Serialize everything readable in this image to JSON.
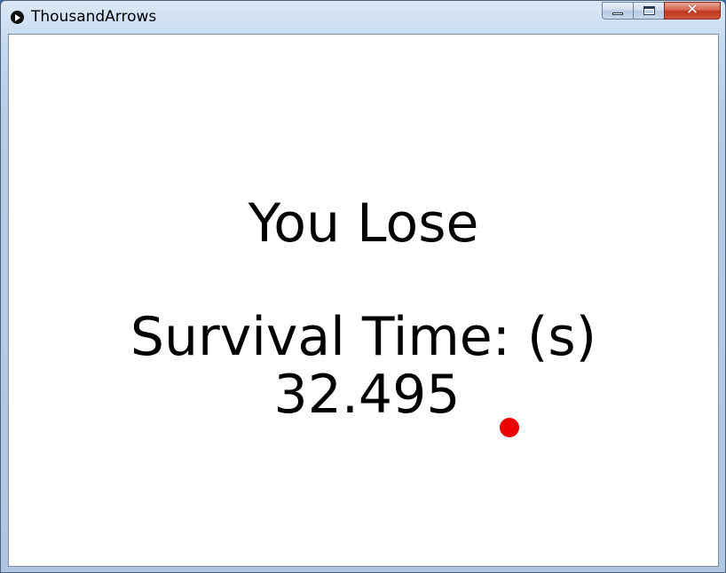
{
  "window": {
    "title": "ThousandArrows",
    "icon": "processing-play-icon",
    "controls": {
      "minimize_icon": "minimize-icon",
      "maximize_icon": "maximize-icon",
      "close_glyph": "✕"
    }
  },
  "game": {
    "result_text": "You Lose",
    "survival_label": "Survival Time: (s)",
    "survival_value": "32.495",
    "player_color": "#ee0000",
    "background_color": "#ffffff"
  }
}
